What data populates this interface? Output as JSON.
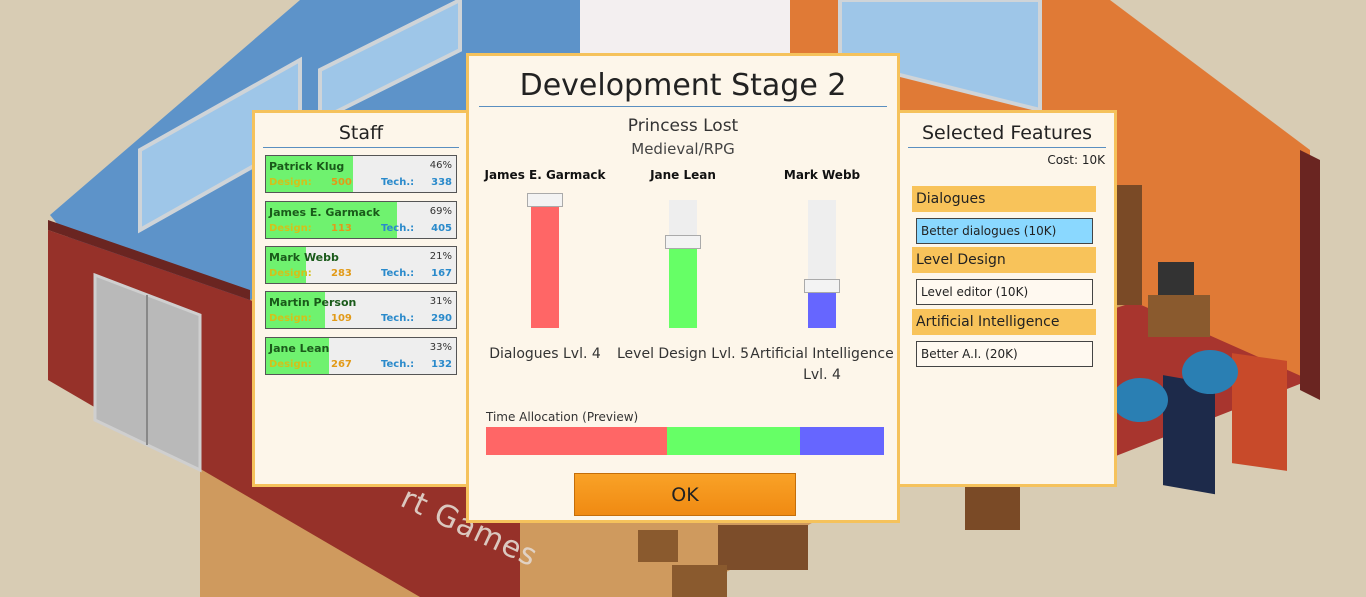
{
  "colors": {
    "panel_border": "#f5c25c",
    "panel_bg": "#fdf6ea",
    "design_color": "#e29a18",
    "tech_color": "#2a8acb",
    "staff_fill": "#6ff26f"
  },
  "scene": {
    "wall_text": "rt Games"
  },
  "staff_panel": {
    "title": "Staff",
    "members": [
      {
        "name": "Patrick Klug",
        "percent": "46%",
        "design_label": "Design:",
        "design": "500",
        "tech_label": "Tech.:",
        "tech": "338",
        "fill": 0.46
      },
      {
        "name": "James E. Garmack",
        "percent": "69%",
        "design_label": "Design:",
        "design": "113",
        "tech_label": "Tech.:",
        "tech": "405",
        "fill": 0.69
      },
      {
        "name": "Mark Webb",
        "percent": "21%",
        "design_label": "Design:",
        "design": "283",
        "tech_label": "Tech.:",
        "tech": "167",
        "fill": 0.21
      },
      {
        "name": "Martin Person",
        "percent": "31%",
        "design_label": "Design:",
        "design": "109",
        "tech_label": "Tech.:",
        "tech": "290",
        "fill": 0.31
      },
      {
        "name": "Jane Lean",
        "percent": "33%",
        "design_label": "Design:",
        "design": "267",
        "tech_label": "Tech.:",
        "tech": "132",
        "fill": 0.33
      }
    ]
  },
  "dev_dialog": {
    "title": "Development Stage 2",
    "game_name": "Princess Lost",
    "genre": "Medieval/RPG",
    "columns": [
      {
        "staff": "James E. Garmack",
        "label": "Dialogues Lvl. 4",
        "level": 1.0,
        "color": "#ff6666"
      },
      {
        "staff": "Jane Lean",
        "label": "Level Design Lvl. 5",
        "level": 0.67,
        "color": "#66ff66"
      },
      {
        "staff": "Mark Webb",
        "label": "Artificial Intelligence Lvl. 4",
        "level": 0.33,
        "color": "#6666ff"
      }
    ],
    "time_allocation_label": "Time Allocation (Preview)",
    "time_allocation": [
      {
        "share": 0.455,
        "color": "#ff6666"
      },
      {
        "share": 0.335,
        "color": "#66ff66"
      },
      {
        "share": 0.21,
        "color": "#6666ff"
      }
    ],
    "ok_label": "OK"
  },
  "features_panel": {
    "title": "Selected Features",
    "cost": "Cost: 10K",
    "categories": [
      {
        "name": "Dialogues",
        "item": "Better dialogues (10K)",
        "selected": true
      },
      {
        "name": "Level Design",
        "item": "Level editor (10K)",
        "selected": false
      },
      {
        "name": "Artificial Intelligence",
        "item": "Better A.I. (20K)",
        "selected": false
      }
    ]
  }
}
